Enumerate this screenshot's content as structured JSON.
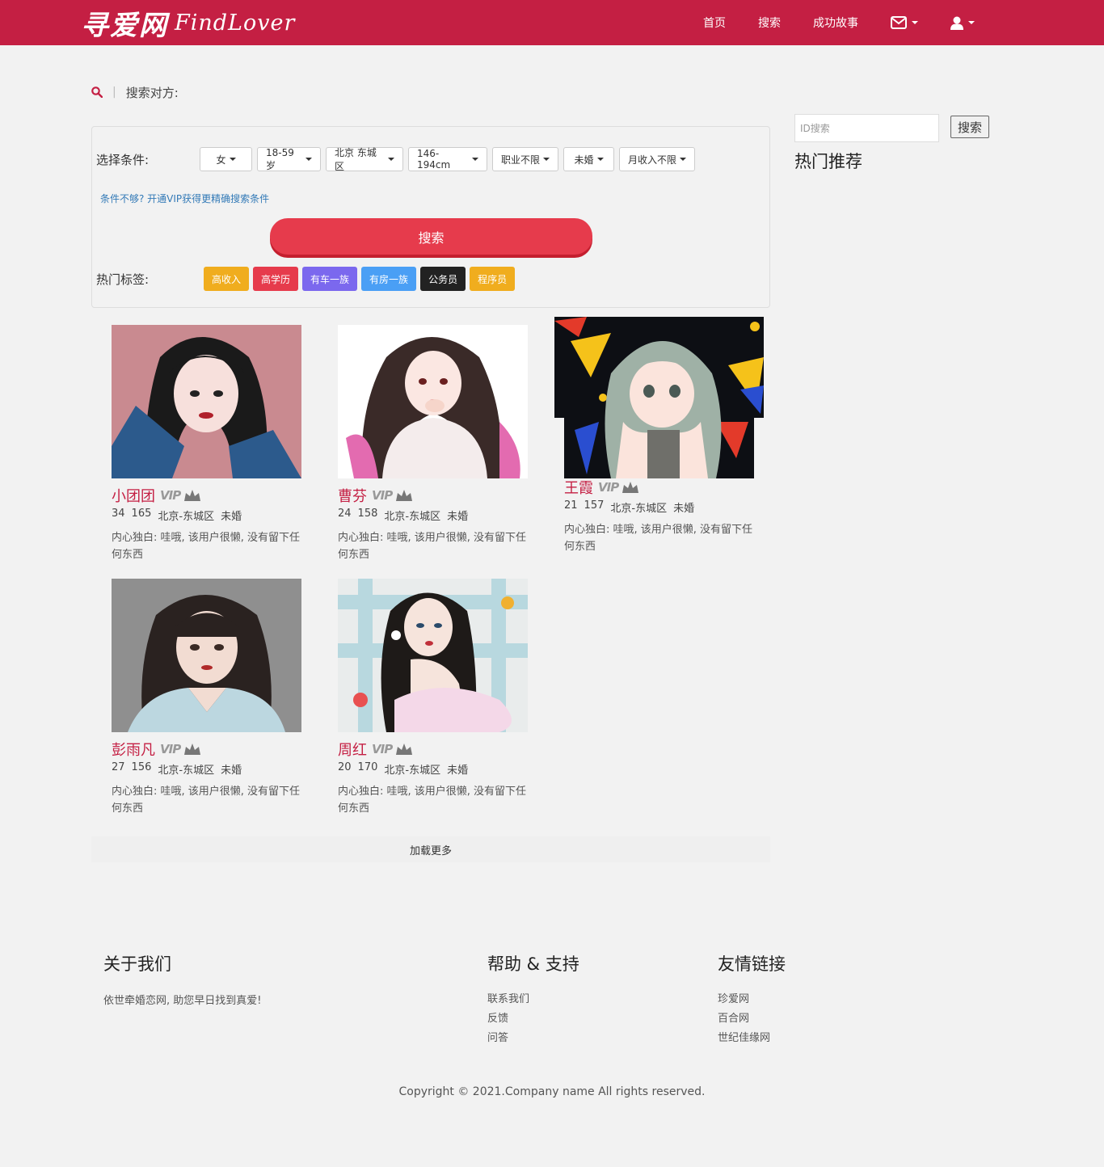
{
  "nav": {
    "brand_cn": "寻爱网",
    "brand_en": "FindLover",
    "links": [
      "首页",
      "搜索",
      "成功故事"
    ]
  },
  "search": {
    "heading": "搜索对方:",
    "filter_label": "选择条件:",
    "filters": [
      "女",
      "18-59岁",
      "北京 东城区",
      "146-194cm",
      "职业不限",
      "未婚",
      "月收入不限"
    ],
    "vip_hint": "条件不够? 开通VIP获得更精确搜索条件",
    "button": "搜索",
    "tags_label": "热门标签:",
    "tags": [
      {
        "label": "高收入",
        "color": "#f0ad1e"
      },
      {
        "label": "高学历",
        "color": "#e63b4c"
      },
      {
        "label": "有车一族",
        "color": "#7b68ee"
      },
      {
        "label": "有房一族",
        "color": "#4a9ff5"
      },
      {
        "label": "公务员",
        "color": "#222222"
      },
      {
        "label": "程序员",
        "color": "#f0ad1e"
      }
    ]
  },
  "profiles": [
    {
      "name": "小团团",
      "vip": "VIP",
      "age": "34",
      "height": "165",
      "city": "北京-东城区",
      "status": "未婚",
      "bio": "内心独白: 哇哦, 该用户很懒, 没有留下任何东西"
    },
    {
      "name": "曹芬",
      "vip": "VIP",
      "age": "24",
      "height": "158",
      "city": "北京-东城区",
      "status": "未婚",
      "bio": "内心独白: 哇哦, 该用户很懒, 没有留下任何东西"
    },
    {
      "name": "王霞",
      "vip": "VIP",
      "age": "21",
      "height": "157",
      "city": "北京-东城区",
      "status": "未婚",
      "bio": "内心独白: 哇哦, 该用户很懒, 没有留下任何东西"
    },
    {
      "name": "彭雨凡",
      "vip": "VIP",
      "age": "27",
      "height": "156",
      "city": "北京-东城区",
      "status": "未婚",
      "bio": "内心独白: 哇哦, 该用户很懒, 没有留下任何东西"
    },
    {
      "name": "周红",
      "vip": "VIP",
      "age": "20",
      "height": "170",
      "city": "北京-东城区",
      "status": "未婚",
      "bio": "内心独白: 哇哦, 该用户很懒, 没有留下任何东西"
    }
  ],
  "load_more": "加载更多",
  "sidebar": {
    "id_placeholder": "ID搜索",
    "id_button": "搜索",
    "hot_title": "热门推荐"
  },
  "footer": {
    "about_title": "关于我们",
    "about_text": "依世牵婚恋网, 助您早日找到真爱!",
    "help_title": "帮助 & 支持",
    "help_links": [
      "联系我们",
      "反馈",
      "问答"
    ],
    "friends_title": "友情链接",
    "friend_links": [
      "珍爱网",
      "百合网",
      "世纪佳缘网"
    ],
    "copyright": "Copyright © 2021.Company name All rights reserved."
  },
  "colors": {
    "brand": "#c41f43",
    "search_button": "#e63b4c",
    "link": "#337ab7"
  }
}
